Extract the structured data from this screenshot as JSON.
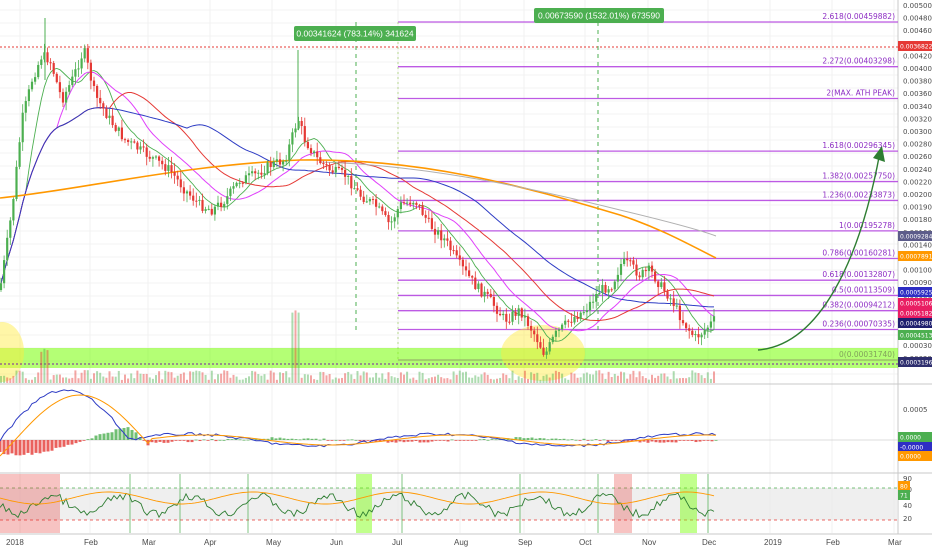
{
  "chart_data": [
    {
      "type": "candlestick",
      "x_ticks": [
        "2018",
        "Feb",
        "Mar",
        "Apr",
        "May",
        "Jun",
        "Jul",
        "Aug",
        "Sep",
        "Oct",
        "Nov",
        "Dec",
        "2019",
        "Feb",
        "Mar"
      ],
      "y_ticks": [
        "0.00500000",
        "0.00480000",
        "0.00460000",
        "0.00440000",
        "0.00420000",
        "0.00400000",
        "0.00380000",
        "0.00360000",
        "0.00340000",
        "0.00320000",
        "0.00300000",
        "0.00280000",
        "0.00260000",
        "0.00240000",
        "0.00220000",
        "0.00200000",
        "0.00190000",
        "0.00180000",
        "0.00160000",
        "0.00140000",
        "0.00120000",
        "0.00100000",
        "0.00090000",
        "0.00080000",
        "0.00065000",
        "0.00050000",
        "0.00040000",
        "0.00030000",
        "0.00029000"
      ],
      "fib_levels": [
        {
          "label": "2.618(0.00459882)",
          "value": 0.00459882
        },
        {
          "label": "2.272(0.00403298)",
          "value": 0.00403298
        },
        {
          "label": "2(MAX. ATH PEAK)",
          "value": 0.00363
        },
        {
          "label": "1.618(0.00296345)",
          "value": 0.00296345
        },
        {
          "label": "1.382(0.00257750)",
          "value": 0.0025775
        },
        {
          "label": "1.236(0.00233873)",
          "value": 0.00233873
        },
        {
          "label": "1(0.00195278)",
          "value": 0.00195278
        },
        {
          "label": "0.786(0.00160281)",
          "value": 0.00160281
        },
        {
          "label": "0.618(0.00132807)",
          "value": 0.00132807
        },
        {
          "label": "0.5(0.00113509)",
          "value": 0.00113509
        },
        {
          "label": "0.382(0.00094212)",
          "value": 0.00094212
        },
        {
          "label": "0.236(0.00070335)",
          "value": 0.00070335
        },
        {
          "label": "0(0.00031740)",
          "value": 0.0003174
        }
      ],
      "price_tags": [
        {
          "text": "0.00368222",
          "color": "#e53935"
        },
        {
          "text": "0.00092845",
          "color": "#5c5c8a"
        },
        {
          "text": "0.00078914",
          "color": "#ff9800"
        },
        {
          "text": "0.00059258",
          "color": "#2e2ec4"
        },
        {
          "text": "0.00051063",
          "color": "#e91e63"
        },
        {
          "text": "0.00051827",
          "color": "#e91e63"
        },
        {
          "text": "0.00049800",
          "color": "#1e1e6e"
        },
        {
          "text": "0.00045135",
          "color": "#4caf50"
        },
        {
          "text": "0.00031969",
          "color": "#2e2e6e"
        }
      ],
      "annotations": [
        {
          "text": "0.00341624 (783.14%) 341624",
          "color": "#4caf50"
        },
        {
          "text": "0.00673590 (1532.01%) 673590",
          "color": "#4caf50"
        }
      ],
      "colors": {
        "up": "#4caf50",
        "down": "#e53935",
        "fib": "#b23ee0",
        "ma_red": "#e53935",
        "ma_orange": "#ff9800",
        "ma_blue": "#2e3cc4",
        "ma_pink": "#e040fb",
        "ma_grey": "#b0b0b0",
        "support": "#76ff03",
        "highlight": "#ffeb3b"
      }
    },
    {
      "type": "macd",
      "y_ticks": [
        "0.0005",
        "0.0000",
        "-0.0000"
      ],
      "price_tags": [
        {
          "text": "0.0000",
          "color": "#4caf50"
        },
        {
          "text": "-0.0000",
          "color": "#2e2ec4"
        },
        {
          "text": "0.0000",
          "color": "#ff9800"
        }
      ]
    },
    {
      "type": "rsi",
      "y_ticks": [
        "90",
        "80",
        "40",
        "20"
      ],
      "price_tags": [
        {
          "text": "80",
          "color": "#ff9800"
        },
        {
          "text": "71",
          "color": "#4caf50"
        }
      ]
    }
  ]
}
